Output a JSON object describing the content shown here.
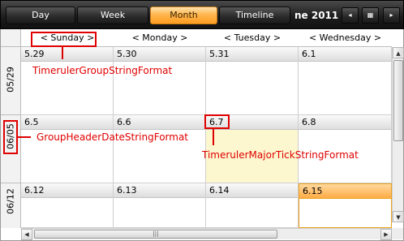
{
  "toolbar": {
    "view_buttons": [
      "Day",
      "Week",
      "Month",
      "Timeline"
    ],
    "active_view": "Month",
    "date_title": "ne 2011",
    "prev_glyph": "◂",
    "picker_glyph": "▦",
    "next_glyph": "▸"
  },
  "day_headers": [
    "< Sunday >",
    "< Monday >",
    "< Tuesday >",
    "< Wednesday >"
  ],
  "week_labels": [
    "05/29",
    "06/05",
    "06/12"
  ],
  "weeks": [
    [
      "5.29",
      "5.30",
      "5.31",
      "6.1"
    ],
    [
      "6.5",
      "6.6",
      "6.7",
      "6.8"
    ],
    [
      "6.12",
      "6.13",
      "6.14",
      "6.15"
    ]
  ],
  "today_cell": "6.7",
  "selected_cell": "6.15",
  "scrollbar": {
    "up": "▲",
    "down": "▼",
    "left": "◀",
    "right": "▶",
    "grip": "|||"
  },
  "annotations": {
    "timeruler_group": "TimerulerGroupStringFormat",
    "group_header_date": "GroupHeaderDateStringFormat",
    "timeruler_major_tick": "TimerulerMajorTickStringFormat"
  },
  "colors": {
    "annotation_red": "#e00000",
    "active_orange": "#ff9c21",
    "today_fill": "#fdf7cf"
  }
}
